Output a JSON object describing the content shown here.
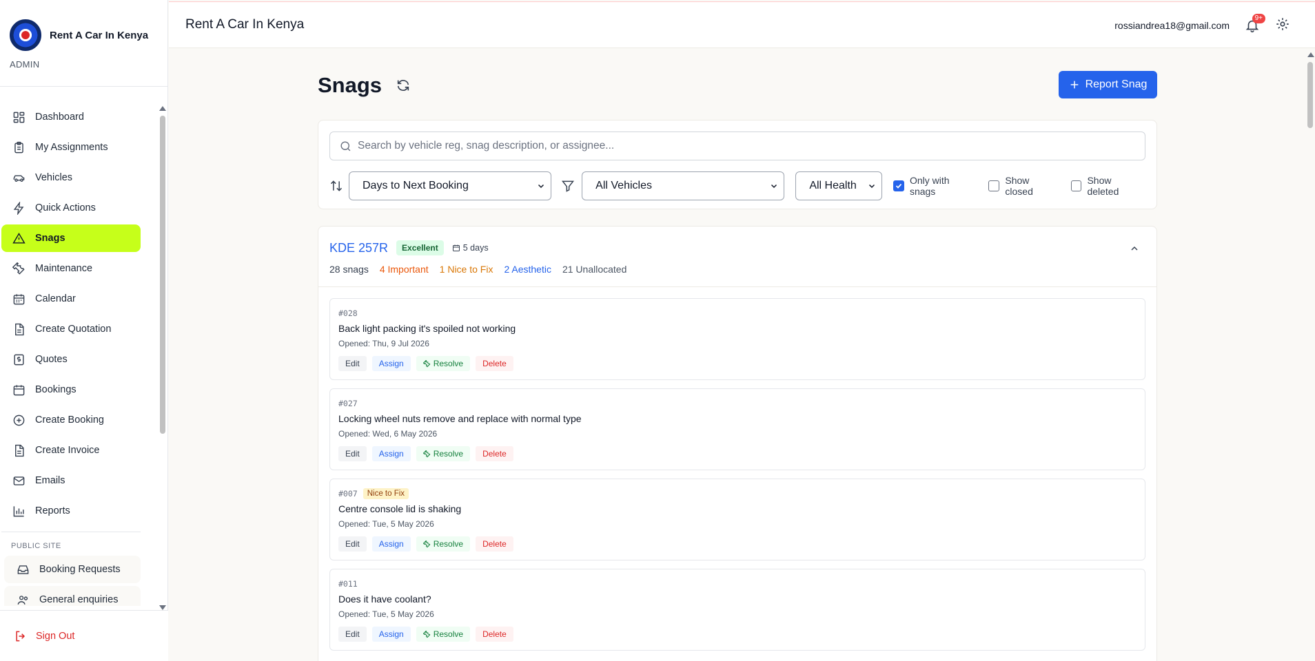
{
  "app": {
    "name": "Rent A Car In Kenya",
    "role": "ADMIN"
  },
  "header": {
    "title": "Rent A Car In Kenya",
    "email": "rossiandrea18@gmail.com",
    "notifications": "9+"
  },
  "sidebar": {
    "items": [
      {
        "label": "Dashboard",
        "icon": "dashboard-icon"
      },
      {
        "label": "My Assignments",
        "icon": "clipboard-icon"
      },
      {
        "label": "Vehicles",
        "icon": "car-icon"
      },
      {
        "label": "Quick Actions",
        "icon": "lightning-icon"
      },
      {
        "label": "Snags",
        "icon": "warning-icon",
        "active": true
      },
      {
        "label": "Maintenance",
        "icon": "wrench-icon"
      },
      {
        "label": "Calendar",
        "icon": "calendar-icon"
      },
      {
        "label": "Create Quotation",
        "icon": "document-icon"
      },
      {
        "label": "Quotes",
        "icon": "dollar-file-icon"
      },
      {
        "label": "Bookings",
        "icon": "calendar-icon"
      },
      {
        "label": "Create Booking",
        "icon": "plus-circle-icon"
      },
      {
        "label": "Create Invoice",
        "icon": "document-icon"
      },
      {
        "label": "Emails",
        "icon": "mail-icon"
      },
      {
        "label": "Reports",
        "icon": "bar-chart-icon"
      }
    ],
    "public_section": "PUBLIC SITE",
    "public_items": [
      {
        "label": "Booking Requests",
        "icon": "inbox-icon"
      },
      {
        "label": "General enquiries",
        "icon": "users-icon"
      }
    ],
    "sign_out": "Sign Out"
  },
  "page": {
    "title": "Snags",
    "report_button": "Report Snag",
    "search_placeholder": "Search by vehicle reg, snag description, or assignee...",
    "sort_value": "Days to Next Booking",
    "vehicle_filter": "All Vehicles",
    "health_filter": "All Health",
    "only_with_snags": {
      "label": "Only with snags",
      "checked": true
    },
    "show_closed": {
      "label": "Show closed",
      "checked": false
    },
    "show_deleted": {
      "label": "Show deleted",
      "checked": false
    }
  },
  "vehicle": {
    "reg": "KDE 257R",
    "health": "Excellent",
    "days": "5 days",
    "counts": {
      "total": "28 snags",
      "important": "4 Important",
      "nice": "1 Nice to Fix",
      "aesthetic": "2 Aesthetic",
      "unallocated": "21 Unallocated"
    }
  },
  "snags": [
    {
      "id": "#028",
      "severity": "",
      "description": "Back light packing it's spoiled not working",
      "opened": "Opened: Thu, 9 Jul 2026"
    },
    {
      "id": "#027",
      "severity": "",
      "description": "Locking wheel nuts remove and replace with normal type",
      "opened": "Opened: Wed, 6 May 2026"
    },
    {
      "id": "#007",
      "severity": "Nice to Fix",
      "description": "Centre console lid is shaking",
      "opened": "Opened: Tue, 5 May 2026"
    },
    {
      "id": "#011",
      "severity": "",
      "description": "Does it have coolant?",
      "opened": "Opened: Tue, 5 May 2026"
    }
  ],
  "snag_actions": {
    "edit": "Edit",
    "assign": "Assign",
    "resolve": "Resolve",
    "delete": "Delete"
  },
  "colors": {
    "accent": "#2563eb",
    "active_nav": "#c6ff1a",
    "danger": "#dc2626"
  }
}
